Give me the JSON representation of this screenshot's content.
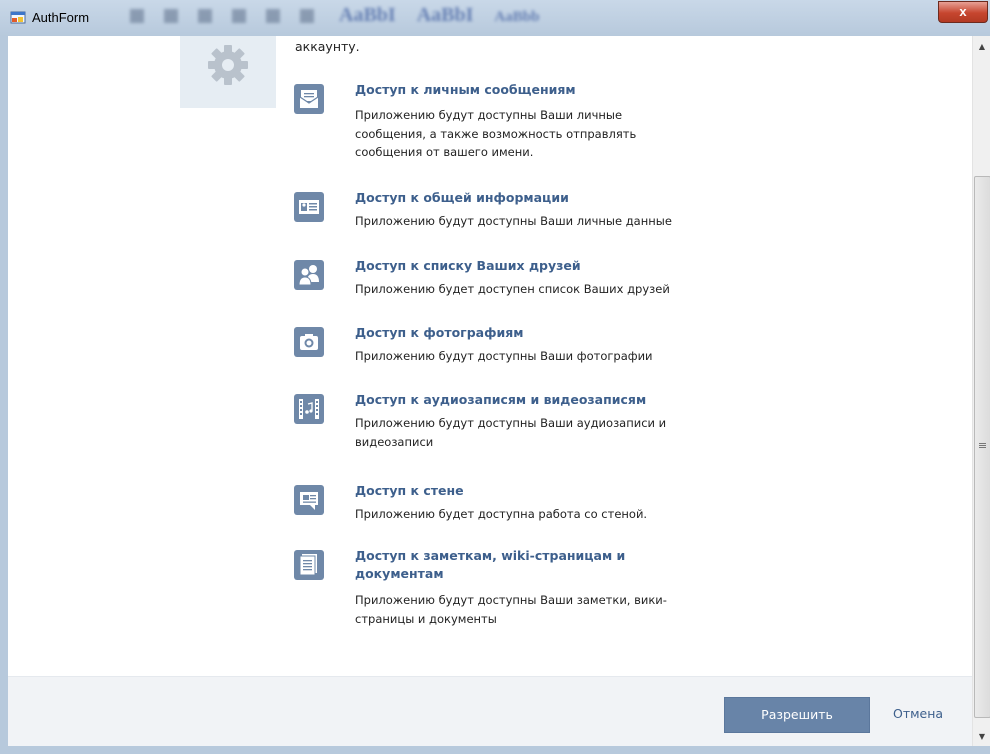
{
  "window": {
    "title": "AuthForm",
    "close_glyph": "x",
    "background_ribbon": [
      "AaBbI",
      "AaBbI",
      "AaBbb"
    ]
  },
  "content": {
    "intro_text": "аккаунту.",
    "app_icon": "gear-icon",
    "permissions": [
      {
        "icon": "envelope-icon",
        "title": "Доступ к личным сообщениям",
        "description_lines": [
          "Приложению будут доступны Ваши личные",
          "сообщения, а также возможность отправлять",
          "сообщения от вашего имени."
        ]
      },
      {
        "icon": "id-card-icon",
        "title": "Доступ к общей информации",
        "description_lines": [
          "Приложению будут доступны Ваши личные данные"
        ]
      },
      {
        "icon": "friends-icon",
        "title": "Доступ к списку Ваших друзей",
        "description_lines": [
          "Приложению будет доступен список Ваших друзей"
        ]
      },
      {
        "icon": "camera-icon",
        "title": "Доступ к фотографиям",
        "description_lines": [
          "Приложению будут доступны Ваши фотографии"
        ]
      },
      {
        "icon": "media-icon",
        "title": "Доступ к аудиозаписям и видеозаписям",
        "description_lines": [
          "Приложению будут доступны Ваши аудиозаписи и",
          "видеозаписи"
        ]
      },
      {
        "icon": "wall-icon",
        "title": "Доступ к стене",
        "description_lines": [
          "Приложению будет доступна работа со стеной."
        ]
      },
      {
        "icon": "notes-icon",
        "title_lines": [
          "Доступ к заметкам, wiki-страницам и",
          "документам"
        ],
        "description_lines": [
          "Приложению будут доступны Ваши заметки, вики-",
          "страницы и документы"
        ]
      }
    ]
  },
  "footer": {
    "allow_label": "Разрешить",
    "cancel_label": "Отмена"
  },
  "colors": {
    "accent": "#6884a8",
    "link": "#3d5f8c",
    "icon_bg": "#6f88a8",
    "footer_bg": "#f1f3f6"
  }
}
